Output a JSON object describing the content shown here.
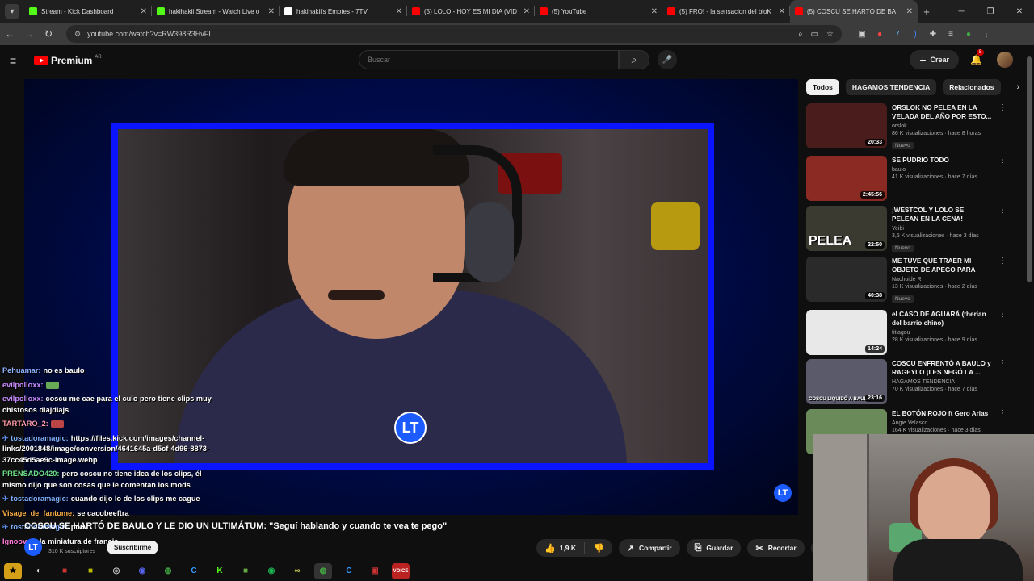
{
  "tabs": [
    {
      "title": "Stream - Kick Dashboard",
      "color": "#53fc18",
      "icon": "kick-icon"
    },
    {
      "title": "hakihakii Stream - Watch Live o",
      "color": "#53fc18",
      "icon": "kick-icon"
    },
    {
      "title": "hakihakii's Emotes - 7TV",
      "color": "#ffffff",
      "icon": "7tv-icon"
    },
    {
      "title": "(5) LOLO - HOY ES MI DIA (VID",
      "color": "#ff0000",
      "icon": "youtube-icon"
    },
    {
      "title": "(5) YouTube",
      "color": "#ff0000",
      "icon": "youtube-icon"
    },
    {
      "title": "(5) FRO! - la sensacion del bloK",
      "color": "#ff0000",
      "icon": "youtube-icon"
    },
    {
      "title": "(5) COSCU SE HARTÓ DE BA",
      "color": "#ff0000",
      "icon": "youtube-icon",
      "active": true
    }
  ],
  "address": {
    "url": "youtube.com/watch?v=RW398R3HvFI"
  },
  "youtube": {
    "logo_text": "Premium",
    "country": "AR",
    "search_placeholder": "Buscar",
    "create_label": "Crear",
    "notifications": "5"
  },
  "video": {
    "title": "COSCU SE HARTÓ DE BAULO Y LE DIO UN ULTIMÁTUM: \"Seguí hablando y cuando te vea te pego\"",
    "channel_subs": "310 K suscriptores",
    "subscribe_label": "Suscribirme",
    "likes": "1,9 K",
    "share_label": "Compartir",
    "save_label": "Guardar",
    "clip_label": "Recortar",
    "logo_mark": "LT"
  },
  "chat": [
    {
      "name": "Pehuamar:",
      "color": "#8fb3ff",
      "text": "no es baulo"
    },
    {
      "name": "evilpolloxx:",
      "color": "#c78bff",
      "text": "",
      "emote": true
    },
    {
      "name": "evilpolloxx:",
      "color": "#c78bff",
      "text": "coscu me cae para el culo pero tiene clips muy chistosos dlajdlajs"
    },
    {
      "name": "TARTARO_2:",
      "color": "#ff9aa8",
      "text": "",
      "emote": true,
      "emote_red": true
    },
    {
      "name": "tostadoramagic:",
      "color": "#7fb0ff",
      "text": "https://files.kick.com/images/channel-links/2001848/image/conversion/4641645a-d5cf-4d96-8873-37cc45d5ae9c-image.webp",
      "pinned": true
    },
    {
      "name": "PRENSADO420:",
      "color": "#6fe38a",
      "text": "pero coscu no tiene idea de los clips, él mismo dijo que son cosas que le comentan los mods"
    },
    {
      "name": "tostadoramagic:",
      "color": "#7fb0ff",
      "text": "cuando dijo lo de los clips me cague",
      "pinned": true
    },
    {
      "name": "Visage_de_fantome:",
      "color": "#ffb347",
      "text": "se cacobeeftra"
    },
    {
      "name": "tostadoramagic:",
      "color": "#7fb0ff",
      "text": "pou",
      "pinned": true
    },
    {
      "name": "Ignoovaz:",
      "color": "#ff7ad9",
      "text": "la miniatura de francis"
    }
  ],
  "sidebar": {
    "chips": [
      "Todos",
      "HAGAMOS TENDENCIA",
      "Relacionados"
    ],
    "videos": [
      {
        "title": "ORSLOK NO PELEA EN LA VELADA DEL AÑO POR ESTO...",
        "channel": "orslok",
        "meta": "86 K visualizaciones · hace 8 horas",
        "duration": "20:33",
        "nuevo": "Nuevo",
        "thumb": "#4a1c1c"
      },
      {
        "title": "SE PUDRIO TODO",
        "channel": "baulo",
        "meta": "41 K visualizaciones · hace 7 días",
        "duration": "2:45:56",
        "thumb": "#8a2a22"
      },
      {
        "title": "¡WESTCOL Y LOLO SE PELEAN EN LA CENA!",
        "channel": "Yeibi",
        "meta": "3,5 K visualizaciones · hace 3 días",
        "duration": "22:50",
        "nuevo": "Nuevo",
        "thumb": "#3a3a30",
        "overlay": "PELEA"
      },
      {
        "title": "ME TUVE QUE TRAER MI OBJETO DE APEGO PARA VER...",
        "channel": "Nachoide R",
        "meta": "13 K visualizaciones · hace 2 días",
        "duration": "40:38",
        "nuevo": "Nuevo",
        "thumb": "#2a2a2a"
      },
      {
        "title": "el CASO DE AGUARÁ (therian del barrio chino)",
        "channel": "titiagou",
        "meta": "28 K visualizaciones · hace 9 días",
        "duration": "14:24",
        "thumb": "#e8e8e8"
      },
      {
        "title": "COSCU ENFRENTÓ A BAULO y RAGEYLO ¡LES NEGÓ LA ...",
        "channel": "HAGAMOS TENDENCIA",
        "meta": "70 K visualizaciones · hace 7 días",
        "duration": "23:16",
        "thumb": "#5a5a6a",
        "overlay": "COSCU LIQUIDÓ A BAULO Y R"
      },
      {
        "title": "EL BOTÓN ROJO ft Gero Arias",
        "channel": "Angie Velasco",
        "meta": "164 K visualizaciones · hace 3 días",
        "duration": "",
        "thumb": "#6a8a5a"
      }
    ]
  }
}
